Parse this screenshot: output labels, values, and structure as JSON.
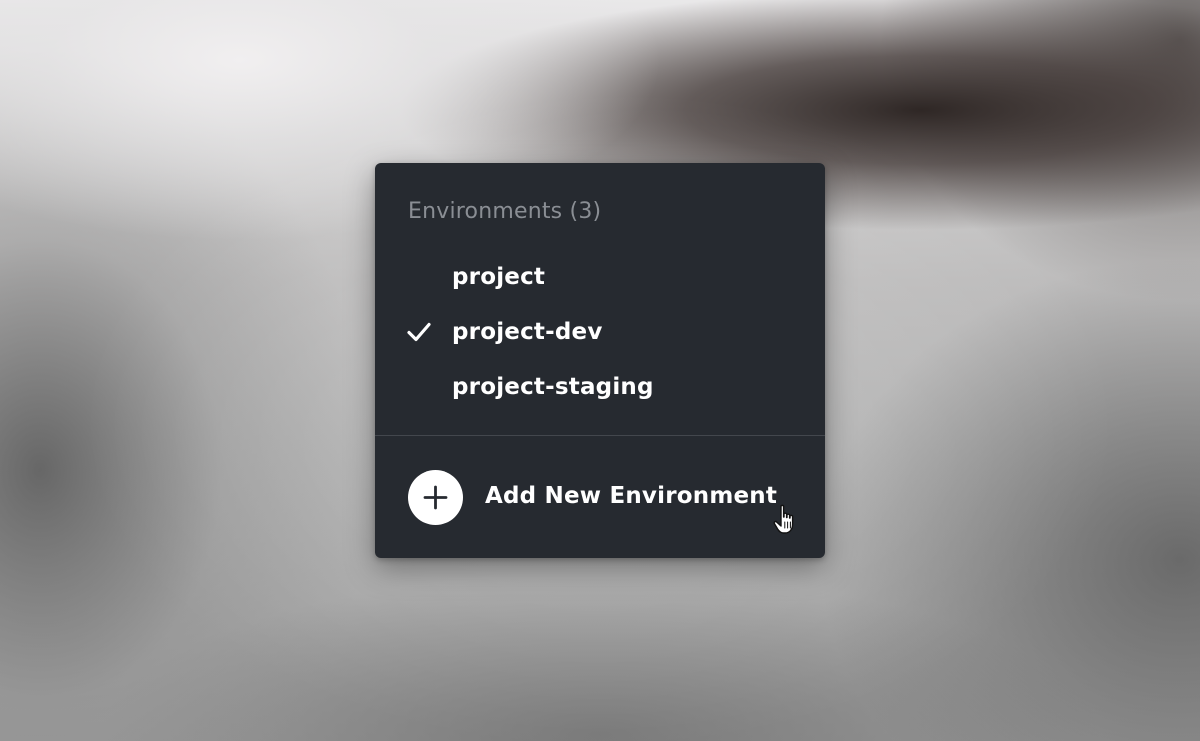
{
  "menu": {
    "header": "Environments (3)",
    "items": [
      {
        "label": "project",
        "selected": false
      },
      {
        "label": "project-dev",
        "selected": true
      },
      {
        "label": "project-staging",
        "selected": false
      }
    ],
    "add_label": "Add New Environment"
  },
  "icons": {
    "selected_marker": "checkmark-icon",
    "add": "plus-icon",
    "cursor": "hand-pointer-cursor-icon"
  },
  "colors": {
    "panel_background": "#262a30",
    "header_text": "#8a8e94",
    "item_text": "#ffffff",
    "divider": "#43474d",
    "add_circle": "#ffffff",
    "add_plus": "#262a30"
  }
}
